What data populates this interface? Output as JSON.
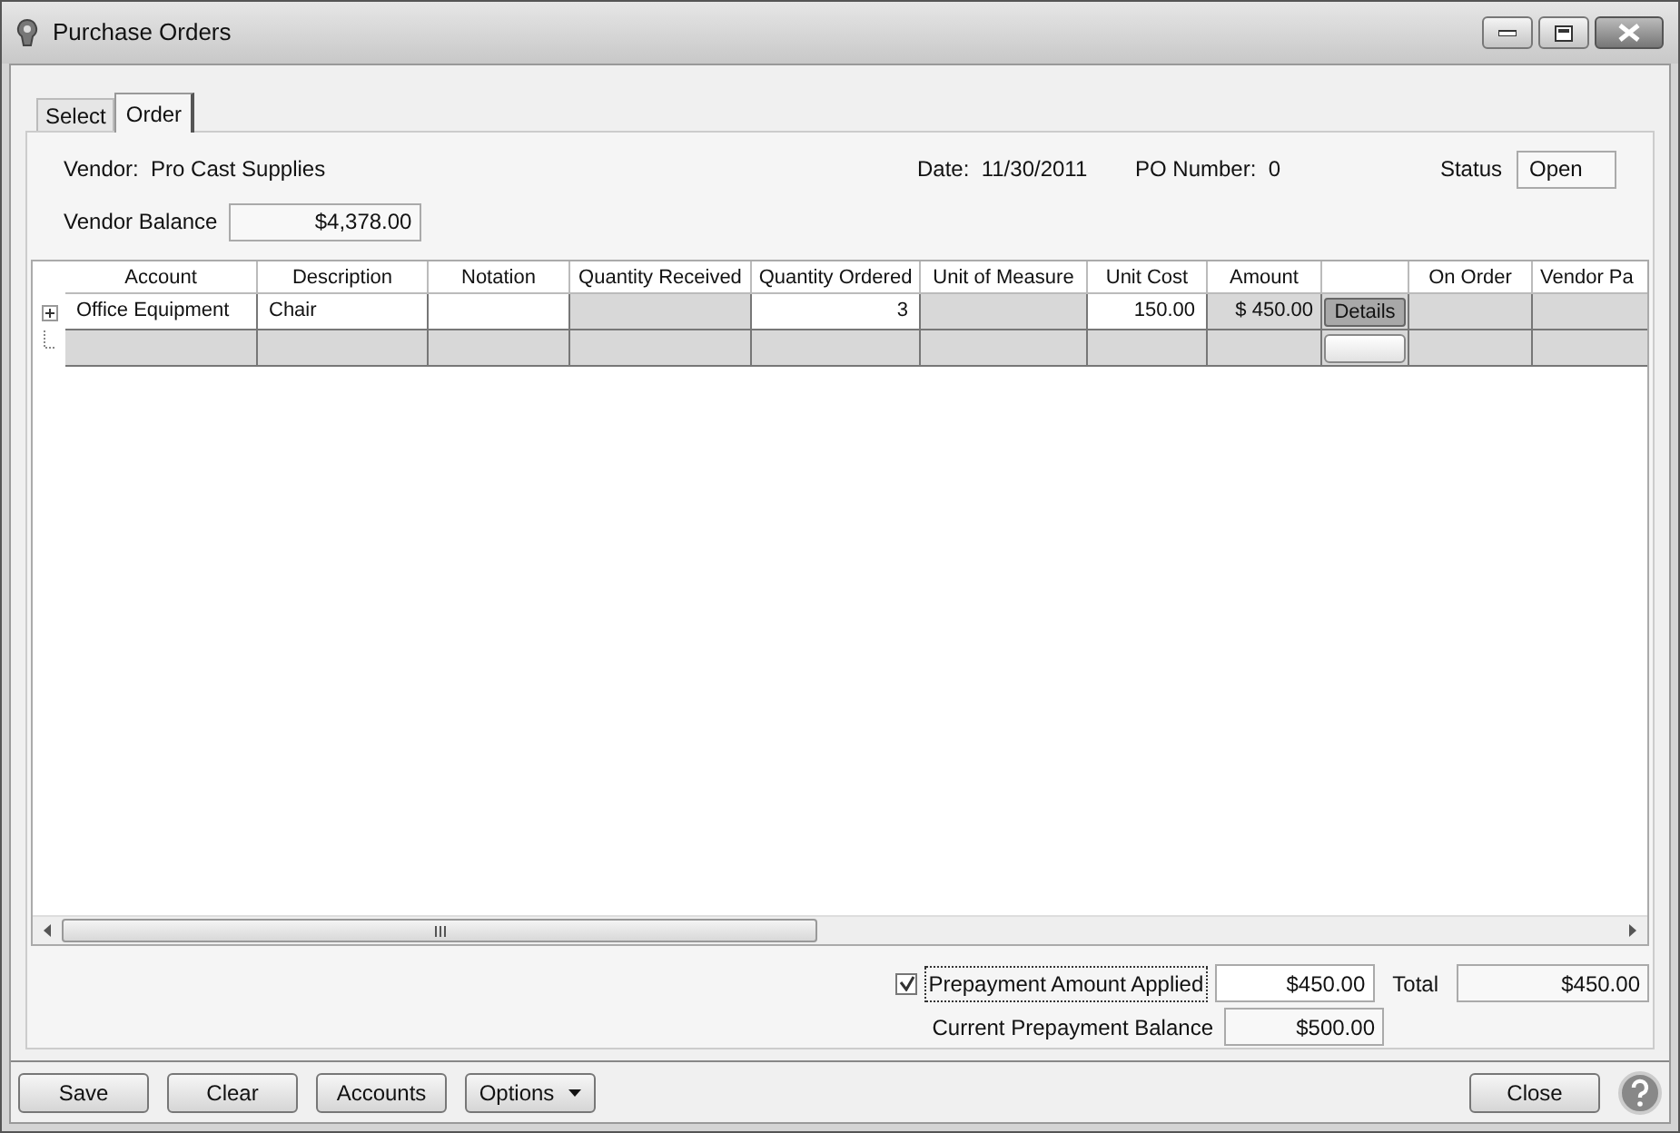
{
  "window": {
    "title": "Purchase Orders"
  },
  "tabs": [
    {
      "label": "Select",
      "selected": false
    },
    {
      "label": "Order",
      "selected": true
    }
  ],
  "header": {
    "vendor_label": "Vendor:",
    "vendor": "Pro Cast Supplies",
    "date_label": "Date:",
    "date": "11/30/2011",
    "po_label": "PO Number:",
    "po_number": "0",
    "status_label": "Status",
    "status": "Open",
    "balance_label": "Vendor Balance",
    "balance": "$4,378.00"
  },
  "table": {
    "columns": [
      "Account",
      "Description",
      "Notation",
      "Quantity Received",
      "Quantity Ordered",
      "Unit of Measure",
      "Unit Cost",
      "Amount",
      "",
      "On Order",
      "Vendor Pa"
    ],
    "rows": [
      {
        "expanded": false,
        "cells": [
          {
            "kind": "edit",
            "text": "Office Equipment"
          },
          {
            "kind": "edit",
            "text": "Chair"
          },
          {
            "kind": "edit"
          },
          {
            "kind": "readonly"
          },
          {
            "kind": "edit",
            "text": "3",
            "numeric": true
          },
          {
            "kind": "readonly"
          },
          {
            "kind": "edit",
            "text": "150.00",
            "numeric": true
          },
          {
            "kind": "readonly",
            "text": "$ 450.00",
            "numeric": true
          },
          {
            "kind": "button",
            "text": "Details"
          },
          {
            "kind": "readonly"
          },
          {
            "kind": "readonly"
          }
        ]
      },
      {
        "cells": [
          {
            "kind": "readonly"
          },
          {
            "kind": "readonly"
          },
          {
            "kind": "readonly"
          },
          {
            "kind": "readonly"
          },
          {
            "kind": "readonly"
          },
          {
            "kind": "readonly"
          },
          {
            "kind": "readonly"
          },
          {
            "kind": "readonly"
          },
          {
            "kind": "button"
          },
          {
            "kind": "readonly"
          },
          {
            "kind": "readonly"
          }
        ]
      }
    ]
  },
  "prepayment": {
    "applied_label": "Prepayment Amount Applied",
    "applied_checked": true,
    "applied": "$450.00",
    "total_label": "Total",
    "total": "$450.00",
    "balance_label": "Current Prepayment Balance",
    "balance": "$500.00"
  },
  "buttons": [
    {
      "label": "Save"
    },
    {
      "label": "Clear"
    },
    {
      "label": "Accounts"
    },
    {
      "label": "Options",
      "dropdown": true
    }
  ],
  "close_button": "Close"
}
